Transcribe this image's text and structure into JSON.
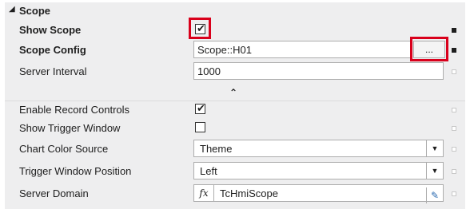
{
  "section": {
    "title": "Scope",
    "collapse_glyph": "◢"
  },
  "rows": {
    "show_scope": {
      "label": "Show Scope",
      "checked": true,
      "check_glyph": "✔"
    },
    "scope_config": {
      "label": "Scope Config",
      "value": "Scope::H01",
      "button_label": "..."
    },
    "server_interval": {
      "label": "Server Interval",
      "value": "1000"
    },
    "enable_record_controls": {
      "label": "Enable Record Controls",
      "checked": true,
      "check_glyph": "✔"
    },
    "show_trigger_window": {
      "label": "Show Trigger Window",
      "checked": false
    },
    "chart_color_source": {
      "label": "Chart Color Source",
      "value": "Theme"
    },
    "trigger_window_position": {
      "label": "Trigger Window Position",
      "value": "Left"
    },
    "server_domain": {
      "label": "Server Domain",
      "value": "TcHmiScope",
      "fx_label": "fx"
    }
  },
  "glyphs": {
    "chevron_up": "⌃",
    "dropdown_arrow": "▼",
    "edit": "✎"
  },
  "colors": {
    "highlight": "#d9001b",
    "panel_bg": "#eeeeef"
  },
  "icons": [
    "collapse-arrow-icon",
    "checkmark-icon",
    "chevron-up-icon",
    "dropdown-arrow-icon",
    "fx-icon",
    "edit-icon"
  ]
}
